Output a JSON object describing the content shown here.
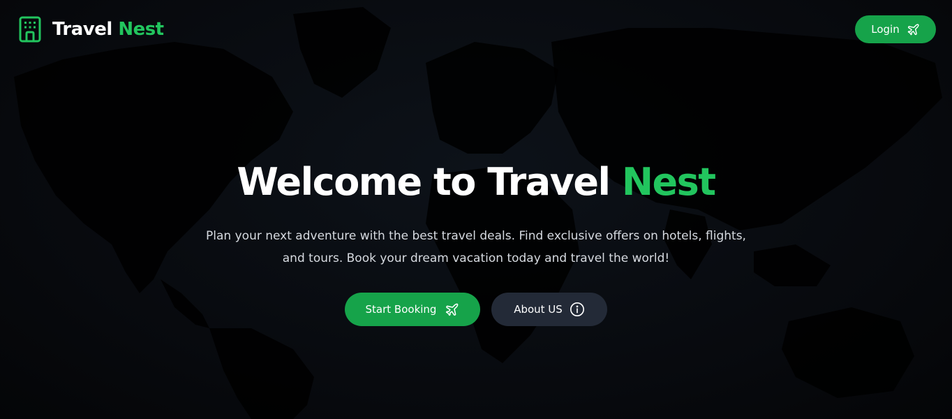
{
  "brand": {
    "name_part1": "Travel",
    "name_part2": "Nest",
    "icon": "building-icon"
  },
  "header": {
    "login_label": "Login",
    "login_icon": "airplane-icon"
  },
  "hero": {
    "title_part1": "Welcome to Travel",
    "title_part2": "Nest",
    "description": "Plan your next adventure with the best travel deals. Find exclusive offers on hotels, flights, and tours. Book your dream vacation today and travel the world!",
    "start_booking_label": "Start Booking",
    "start_booking_icon": "airplane-icon",
    "about_label": "About US",
    "about_icon": "info-icon"
  },
  "background": {
    "image": "world-map"
  },
  "colors": {
    "accent": "#22c55e",
    "button_primary": "#16a34a",
    "button_secondary": "#232a37",
    "background": "#0b0f15",
    "text_primary": "#ffffff",
    "text_muted": "#d6dae0"
  }
}
